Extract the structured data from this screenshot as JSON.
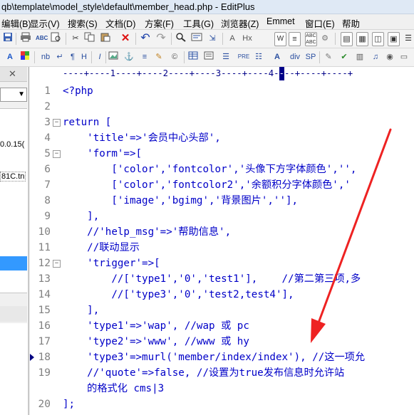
{
  "window": {
    "title": "qb\\template\\model_style\\default\\member_head.php - EditPlus"
  },
  "menu": [
    {
      "label": "编辑(B)"
    },
    {
      "label": "显示(V)"
    },
    {
      "label": "搜索(S)"
    },
    {
      "label": "文档(D)"
    },
    {
      "label": "方案(F)"
    },
    {
      "label": "工具(G)"
    },
    {
      "label": "浏览器(Z)"
    },
    {
      "label": "Emmet"
    },
    {
      "label": "窗口(E)"
    },
    {
      "label": "帮助"
    }
  ],
  "toolbar2": {
    "nb_label": "nb",
    "pre_label": "PRE",
    "div_label": "div",
    "sp_label": "SP",
    "hx_label": "Hx"
  },
  "sidebar": {
    "tree_item_1": "0.0.15(",
    "tree_item_2": "81C.tn"
  },
  "ruler": {
    "before": "----+----1----+----2----+----3----+----4-",
    "cursor": "-",
    "after": "--+----+----+"
  },
  "editor": {
    "lines": [
      {
        "n": "1",
        "code": "<?php"
      },
      {
        "n": "2",
        "code": ""
      },
      {
        "n": "3",
        "code": "return ["
      },
      {
        "n": "4",
        "code": "    'title'=>'会员中心头部',"
      },
      {
        "n": "5",
        "code": "    'form'=>["
      },
      {
        "n": "6",
        "code": "        ['color','fontcolor','头像下方字体颜色','',"
      },
      {
        "n": "7",
        "code": "        ['color','fontcolor2','余额积分字体颜色','"
      },
      {
        "n": "8",
        "code": "        ['image','bgimg','背景图片',''],"
      },
      {
        "n": "9",
        "code": "    ],"
      },
      {
        "n": "10",
        "code": "    //'help_msg'=>'帮助信息',"
      },
      {
        "n": "11",
        "code": "    //联动显示"
      },
      {
        "n": "12",
        "code": "    'trigger'=>["
      },
      {
        "n": "13",
        "code": "        //['type1','0','test1'],    //第二第三项,多"
      },
      {
        "n": "14",
        "code": "        //['type3','0','test2,test4'],"
      },
      {
        "n": "15",
        "code": "    ],"
      },
      {
        "n": "16",
        "code": "    'type1'=>'wap', //wap 或 pc"
      },
      {
        "n": "17",
        "code": "    'type2'=>'www', //www 或 hy"
      },
      {
        "n": "18",
        "code": "    'type3'=>murl('member/index/index'), //这一项允"
      },
      {
        "n": "19",
        "code": "    //'quote'=>false, //设置为true发布信息时允许站"
      },
      {
        "n": "",
        "code": "    的格式化 cms|3"
      },
      {
        "n": "20",
        "code": "];"
      }
    ]
  },
  "colors": {
    "code_text": "#0000c8",
    "line_number": "#808080",
    "annotation_arrow": "#ee2222",
    "selection": "#3399ff"
  }
}
